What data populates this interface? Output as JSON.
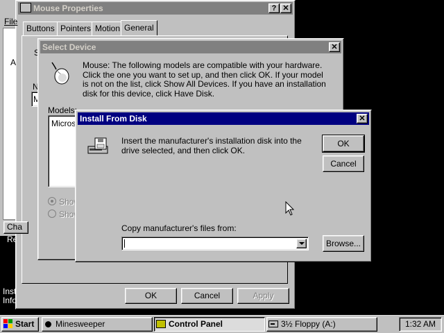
{
  "desktop": {
    "left_fragments": [
      "Re",
      "Inst",
      "Info"
    ]
  },
  "mouse_properties": {
    "title": "Mouse Properties",
    "menu_fragment": "File",
    "left_fragment": "A",
    "tabs": [
      "Buttons",
      "Pointers",
      "Motion",
      "General"
    ],
    "active_tab": "General",
    "side_fragments": [
      "S",
      "N",
      "M"
    ],
    "lower_fragment": "Cha",
    "ok_label": "OK",
    "cancel_label": "Cancel",
    "apply_label": "Apply"
  },
  "select_device": {
    "title": "Select Device",
    "description": "Mouse: The following models are compatible with your hardware. Click the one you want to set up, and then click OK. If your model is not on the list, click Show All Devices. If you have an installation disk for this device, click Have Disk.",
    "models_label": "Models:",
    "model_fragment": "Microsc",
    "radio_fragments": [
      "Show",
      "Show"
    ]
  },
  "install_from_disk": {
    "title": "Install From Disk",
    "message": "Insert the manufacturer's installation disk into the drive selected, and then click OK.",
    "ok_label": "OK",
    "cancel_label": "Cancel",
    "copy_label": "Copy manufacturer's files from:",
    "copy_value": "",
    "browse_label": "Browse..."
  },
  "taskbar": {
    "start_label": "Start",
    "tasks": [
      {
        "label": "Minesweeper",
        "active": false
      },
      {
        "label": "Control Panel",
        "active": true
      },
      {
        "label": "3½ Floppy (A:)",
        "active": false
      }
    ],
    "clock": "1:32 AM"
  },
  "colors": {
    "desktop": "#000000",
    "face": "#c0c0c0",
    "active_title": "#000080",
    "inactive_title": "#808080"
  }
}
